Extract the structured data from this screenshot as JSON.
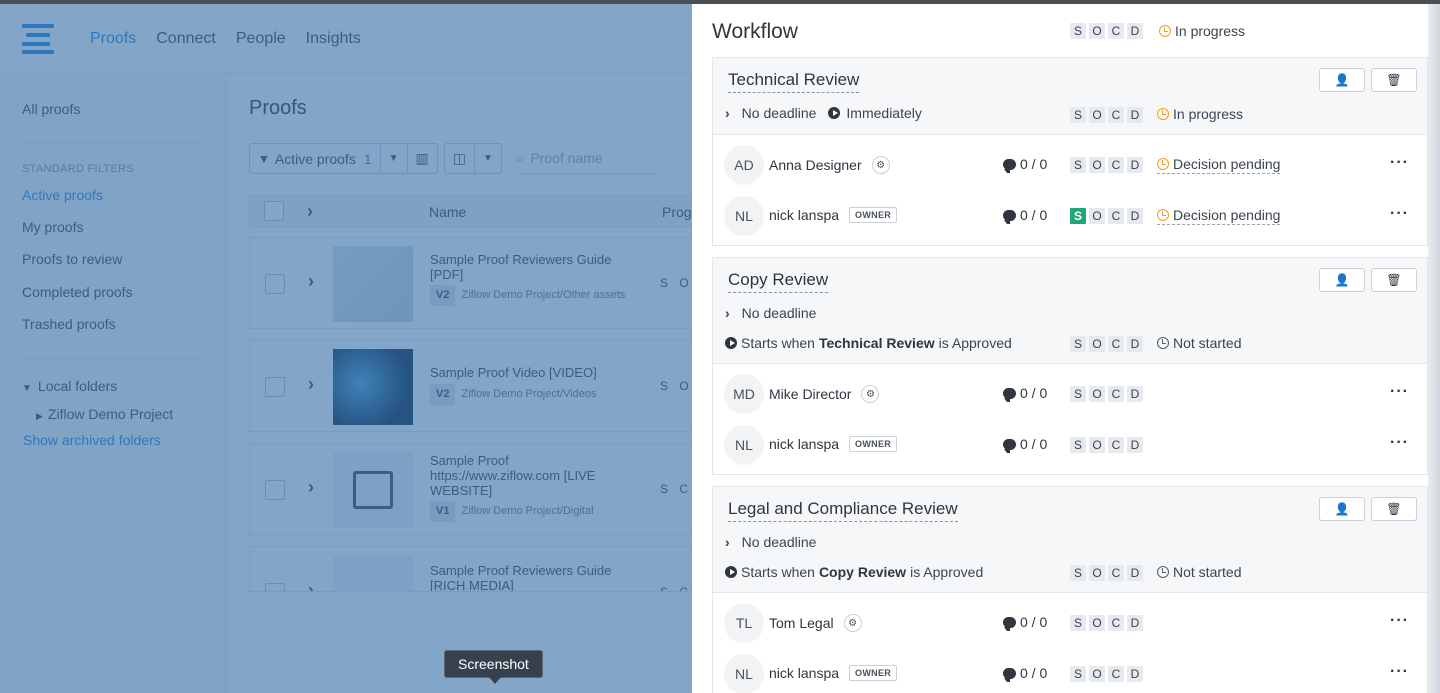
{
  "app": {
    "nav": [
      {
        "label": "Proofs",
        "active": true
      },
      {
        "label": "Connect"
      },
      {
        "label": "People"
      },
      {
        "label": "Insights"
      }
    ],
    "sidebar": {
      "all_proofs": "All proofs",
      "section_standard": "STANDARD FILTERS",
      "filters": [
        "Active proofs",
        "My proofs",
        "Proofs to review",
        "Completed proofs",
        "Trashed proofs"
      ],
      "local_folders": "Local folders",
      "folder": "Ziflow Demo Project",
      "show_archived": "Show archived folders"
    },
    "main": {
      "title": "Proofs",
      "filter_label": "Active proofs",
      "filter_count": "1",
      "search_placeholder": "Proof name",
      "col_name": "Name",
      "col_progress": "Prog",
      "rows": [
        {
          "name": "Sample Proof Reviewers Guide [PDF]",
          "version": "V2",
          "path": "Ziflow Demo Project/Other assets",
          "socd": "S O"
        },
        {
          "name": "Sample Proof Video [VIDEO]",
          "version": "V2",
          "path": "Ziflow Demo Project/Videos",
          "socd": "S O"
        },
        {
          "name": "Sample Proof https://www.ziflow.com [LIVE WEBSITE]",
          "version": "V1",
          "path": "Ziflow Demo Project/Digital",
          "socd": "S C"
        },
        {
          "name": "Sample Proof Reviewers Guide [RICH MEDIA]",
          "version": "",
          "path": "",
          "socd": "S C"
        }
      ]
    },
    "tooltip": "Screenshot"
  },
  "workflow": {
    "title": "Workflow",
    "socd": [
      "S",
      "O",
      "C",
      "D"
    ],
    "status": "In progress",
    "stages": [
      {
        "name": "Technical Review",
        "deadline": "No deadline",
        "start": "Immediately",
        "status": "In progress",
        "reviewers": [
          {
            "initials": "AD",
            "name": "Anna Designer",
            "tag": "gear",
            "comments": "0 / 0",
            "status": "Decision pending",
            "s_done": false
          },
          {
            "initials": "NL",
            "name": "nick lanspa",
            "tag": "OWNER",
            "comments": "0 / 0",
            "status": "Decision pending",
            "s_done": true
          }
        ]
      },
      {
        "name": "Copy Review",
        "deadline": "No deadline",
        "start_prefix": "Starts when",
        "start_stage": "Technical Review",
        "start_suffix": "is Approved",
        "status": "Not started",
        "reviewers": [
          {
            "initials": "MD",
            "name": "Mike Director",
            "tag": "gear",
            "comments": "0 / 0",
            "status": "",
            "s_done": false
          },
          {
            "initials": "NL",
            "name": "nick lanspa",
            "tag": "OWNER",
            "comments": "0 / 0",
            "status": "",
            "s_done": false
          }
        ]
      },
      {
        "name": "Legal and Compliance Review",
        "deadline": "No deadline",
        "start_prefix": "Starts when",
        "start_stage": "Copy Review",
        "start_suffix": "is Approved",
        "status": "Not started",
        "reviewers": [
          {
            "initials": "TL",
            "name": "Tom Legal",
            "tag": "gear",
            "comments": "0 / 0",
            "status": "",
            "s_done": false
          },
          {
            "initials": "NL",
            "name": "nick lanspa",
            "tag": "OWNER",
            "comments": "0 / 0",
            "status": "",
            "s_done": false
          }
        ]
      }
    ]
  },
  "colors": {
    "accent": "#1e88e5",
    "overlay": "#376ea5",
    "approved_green": "#1fa67a",
    "pending_orange": "#f0a020"
  }
}
